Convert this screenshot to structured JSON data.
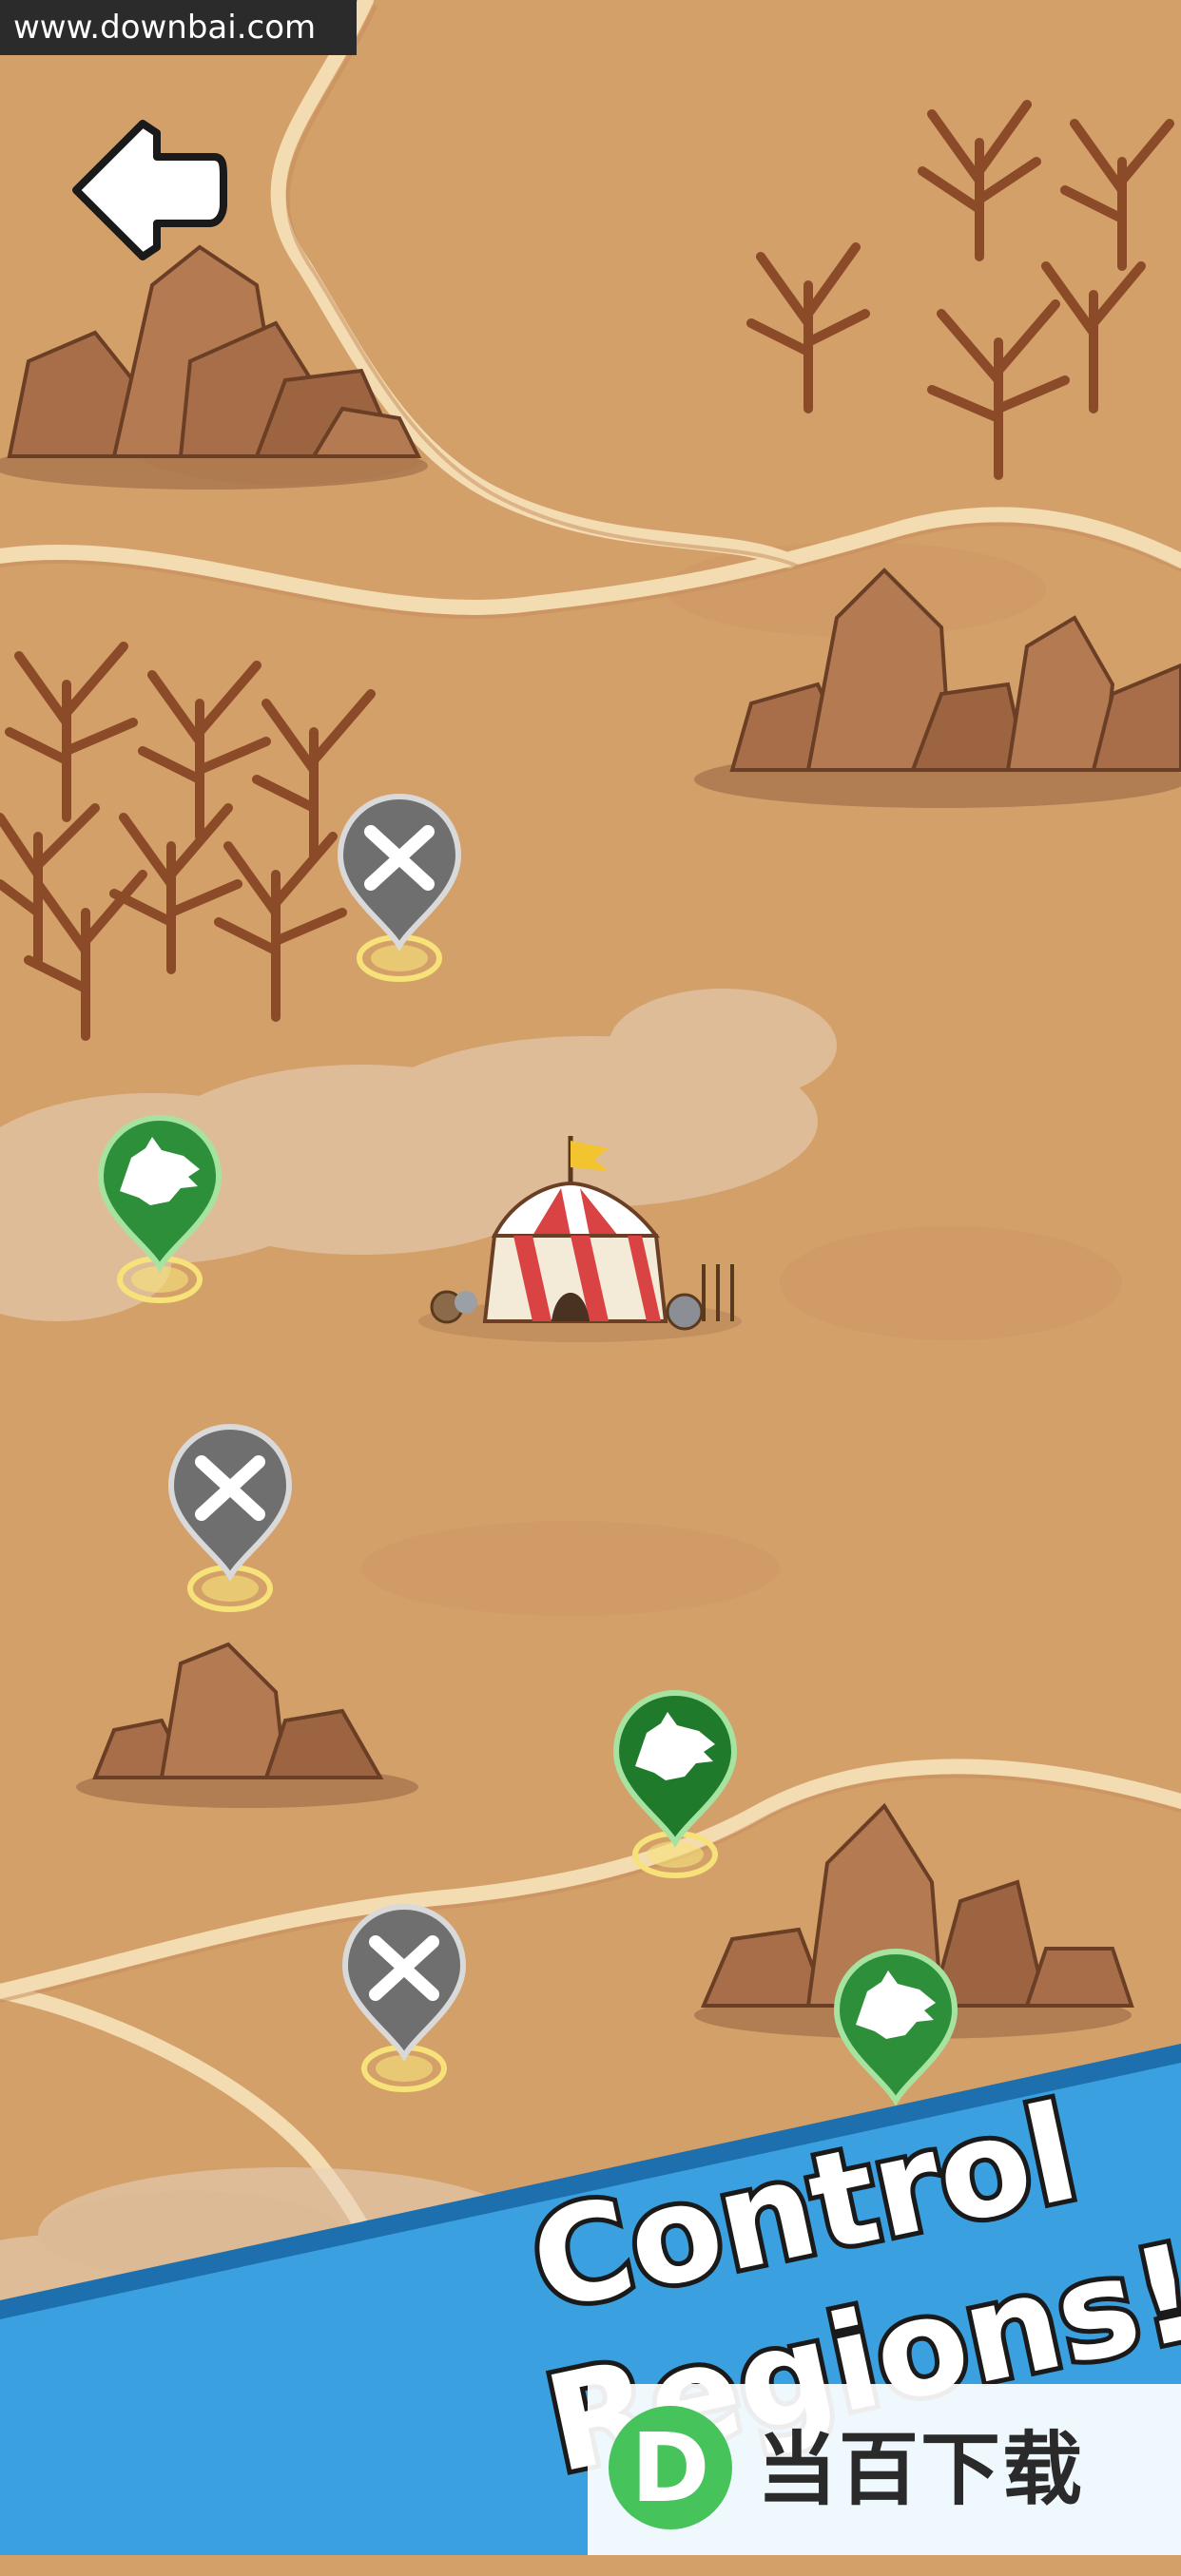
{
  "watermark": {
    "url_text": "www.downbai.com",
    "brand_text": "当百下载",
    "brand_logo_letter": "D"
  },
  "navigation": {
    "back_icon": "back-arrow-icon"
  },
  "map": {
    "colors": {
      "ground": "#d4a06a",
      "road": "#f4dcb2",
      "rock": "#a86e49",
      "tree": "#a0522d"
    },
    "markers": [
      {
        "kind": "battle",
        "icon": "crossed-swords-icon",
        "state": "locked",
        "color": "#6f6f6f"
      },
      {
        "kind": "wolf",
        "icon": "wolf-head-icon",
        "state": "controlled",
        "color": "#2e8f3a"
      },
      {
        "kind": "battle",
        "icon": "crossed-swords-icon",
        "state": "locked",
        "color": "#6f6f6f"
      },
      {
        "kind": "wolf",
        "icon": "wolf-head-icon",
        "state": "controlled",
        "color": "#1f7a2c"
      },
      {
        "kind": "battle",
        "icon": "crossed-swords-icon",
        "state": "locked",
        "color": "#6f6f6f"
      },
      {
        "kind": "wolf",
        "icon": "wolf-head-icon",
        "state": "controlled",
        "color": "#2e8f3a"
      }
    ],
    "camp": {
      "icon": "circus-tent-icon",
      "stripe_color": "#d94343"
    }
  },
  "promo": {
    "line1": "Control",
    "line2": "Regions!",
    "banner_color": "#3aa0e0"
  }
}
